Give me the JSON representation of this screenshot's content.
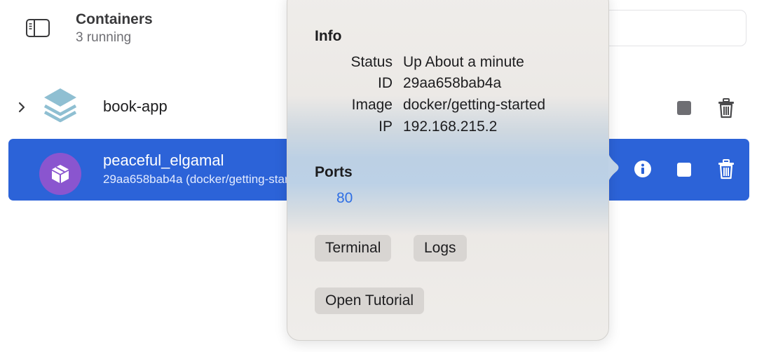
{
  "header": {
    "title": "Containers",
    "subtitle": "3 running"
  },
  "containers": [
    {
      "name": "book-app",
      "icon": "stack-icon"
    },
    {
      "name": "peaceful_elgamal",
      "subtitle": "29aa658bab4a (docker/getting-started)",
      "icon": "cube-icon",
      "selected": true
    }
  ],
  "popover": {
    "info_title": "Info",
    "info": {
      "status_label": "Status",
      "status_value": "Up About a minute",
      "id_label": "ID",
      "id_value": "29aa658bab4a",
      "image_label": "Image",
      "image_value": "docker/getting-started",
      "ip_label": "IP",
      "ip_value": "192.168.215.2"
    },
    "ports_title": "Ports",
    "port": "80",
    "buttons": {
      "terminal": "Terminal",
      "logs": "Logs",
      "tutorial": "Open Tutorial"
    }
  },
  "colors": {
    "selection": "#2c63d8",
    "avatar": "#8a55cf",
    "link": "#2f6fe4",
    "stack_icon": "#8fbfd2"
  }
}
